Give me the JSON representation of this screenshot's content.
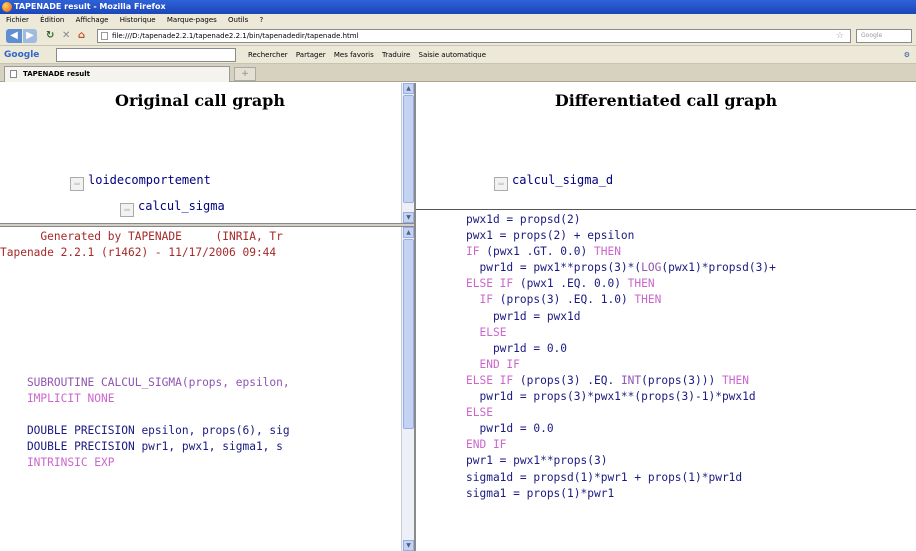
{
  "window": {
    "title": "TAPENADE result - Mozilla Firefox"
  },
  "menu": [
    "Fichier",
    "Édition",
    "Affichage",
    "Historique",
    "Marque-pages",
    "Outils",
    "?"
  ],
  "nav": {
    "url": "file:///D:/tapenade2.2.1/tapenade2.2.1/bin/tapenadedir/tapenade.html",
    "search_placeholder": "Google"
  },
  "google_bar": {
    "logo": "Google",
    "items": [
      "Rechercher",
      "Partager",
      "Mes favoris",
      "Traduire",
      "Saisie automatique"
    ]
  },
  "tab": {
    "title": "TAPENADE result",
    "new_tab": "+"
  },
  "left_top": {
    "heading": "Original call graph",
    "nodes": [
      "loidecomportement",
      "calcul_sigma"
    ]
  },
  "right_top": {
    "heading": "Differentiated call graph",
    "nodes": [
      "calcul_sigma_d"
    ]
  },
  "left_bottom": {
    "header": [
      "      Generated by TAPENADE     (INRIA, Tr",
      "Tapenade 2.2.1 (r1462) - 11/17/2006 09:44"
    ],
    "code": [
      {
        "line": "    SUBROUTINE CALCUL_SIGMA(props, epsilon,",
        "kind": "sub"
      },
      {
        "line": "    IMPLICIT NONE",
        "kind": "kw"
      },
      {
        "line": "",
        "kind": "bl"
      },
      {
        "line": "    DOUBLE PRECISION epsilon, props(6), sig",
        "kind": "bl"
      },
      {
        "line": "    DOUBLE PRECISION pwr1, pwx1, sigma1, s",
        "kind": "bl"
      },
      {
        "line": "    INTRINSIC EXP",
        "kind": "kw"
      }
    ]
  },
  "right_bottom": {
    "code": [
      "pwx1d = propsd(2)",
      "pwx1 = props(2) + epsilon",
      "IF (pwx1 .GT. 0.0) THEN",
      "  pwr1d = pwx1**props(3)*(LOG(pwx1)*propsd(3)+",
      "ELSE IF (pwx1 .EQ. 0.0) THEN",
      "  IF (props(3) .EQ. 1.0) THEN",
      "    pwr1d = pwx1d",
      "  ELSE",
      "    pwr1d = 0.0",
      "  END IF",
      "ELSE IF (props(3) .EQ. INT(props(3))) THEN",
      "  pwr1d = props(3)*pwx1**(props(3)-1)*pwx1d",
      "ELSE",
      "  pwr1d = 0.0",
      "END IF",
      "pwr1 = pwx1**props(3)",
      "sigma1d = propsd(1)*pwr1 + props(1)*pwr1d",
      "sigma1 = props(1)*pwr1"
    ]
  }
}
